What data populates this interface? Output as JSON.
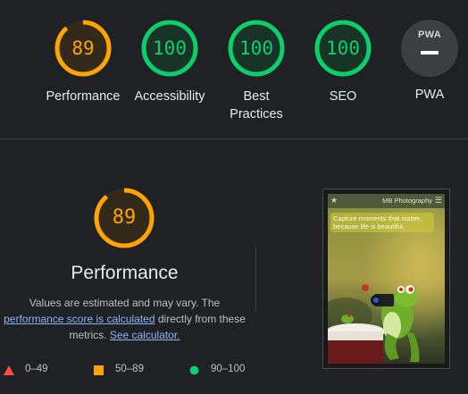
{
  "summary": {
    "gauges": [
      {
        "score": "89",
        "label": "Performance",
        "color": "#ffa400",
        "fraction": 0.89
      },
      {
        "score": "100",
        "label": "Accessibility",
        "color": "#0cce6b",
        "fraction": 1.0
      },
      {
        "score": "100",
        "label": "Best Practices",
        "color": "#0cce6b",
        "fraction": 1.0
      },
      {
        "score": "100",
        "label": "SEO",
        "color": "#0cce6b",
        "fraction": 1.0
      }
    ],
    "pwa": {
      "badge_text": "PWA",
      "label": "PWA"
    }
  },
  "performance": {
    "score": "89",
    "fraction": 0.89,
    "color": "#ffa400",
    "title": "Performance",
    "desc_line1": "Values are estimated and may vary. The",
    "score_link": "performance score is calculated",
    "desc_mid": "directly from these",
    "desc_prefix2": "metrics.",
    "calc_link": "See calculator."
  },
  "legend": {
    "fail": {
      "text": "0–49",
      "color": "#ff4e42"
    },
    "average": {
      "text": "50–89",
      "color": "#ffa400"
    },
    "pass": {
      "text": "90–100",
      "color": "#0cce6b"
    }
  },
  "screenshot": {
    "site_title": "MB Photography",
    "star": "★",
    "menu_icon": "hamburger-icon",
    "caption": "Capture moments that matter, because life is beautiful."
  }
}
